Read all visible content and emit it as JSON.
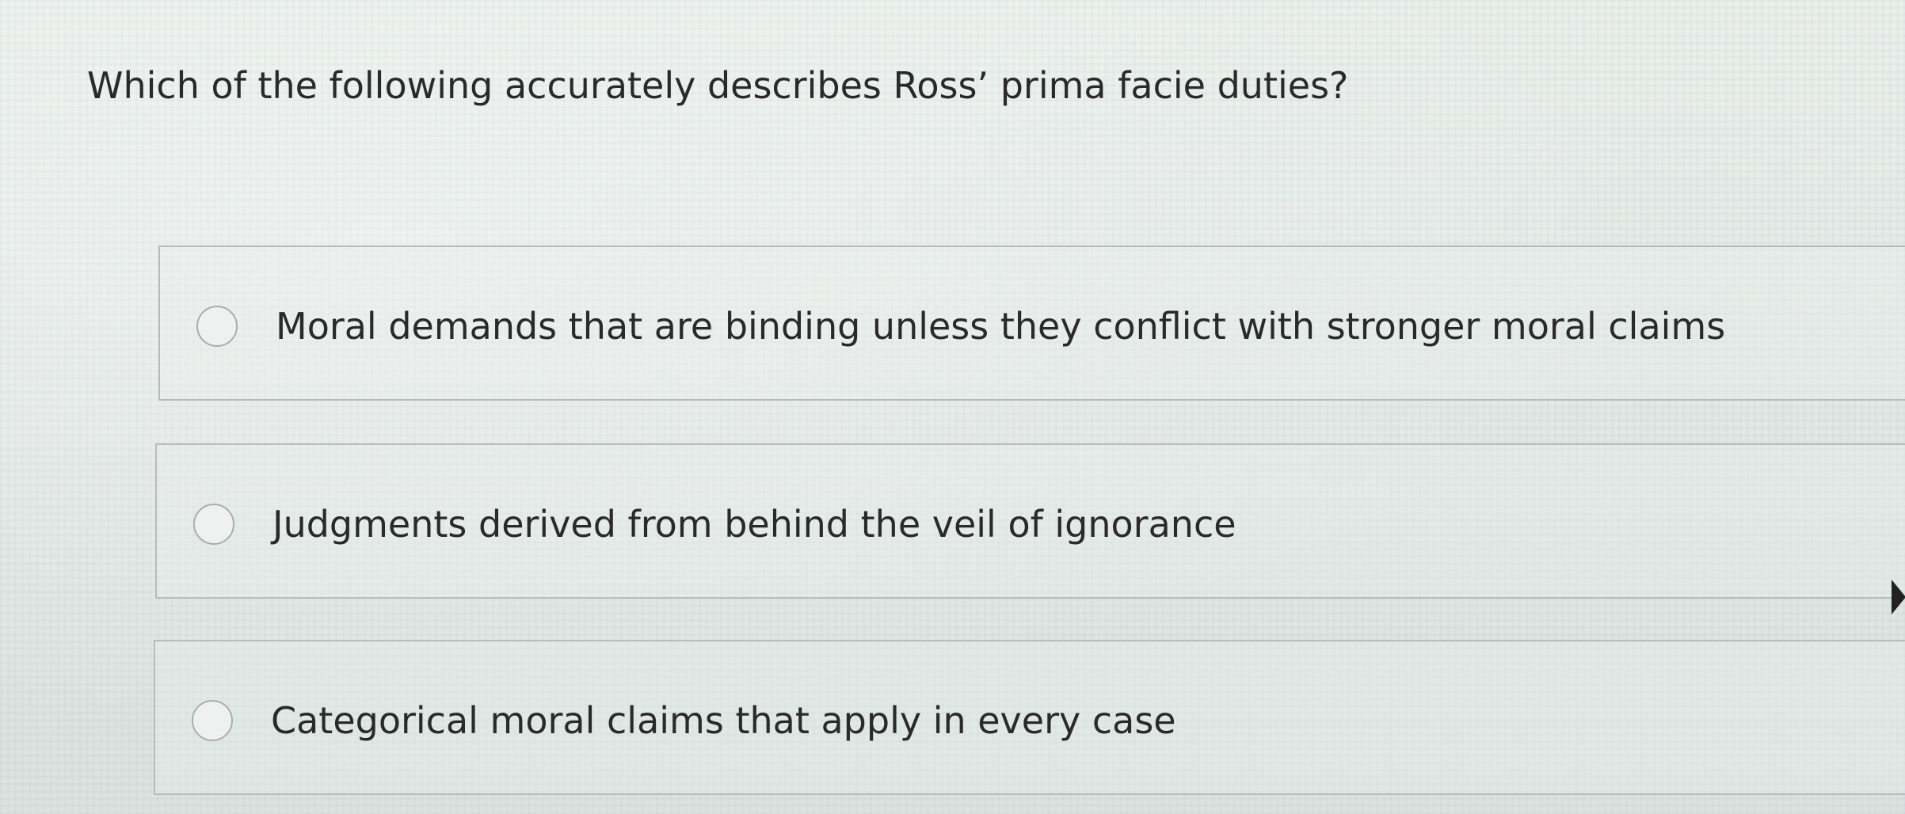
{
  "question": {
    "text": "Which of the following accurately describes Ross’ prima facie duties?"
  },
  "options": [
    {
      "label": "Moral demands that are binding unless they conflict with stronger moral claims",
      "selected": false
    },
    {
      "label": "Judgments derived from behind the veil of ignorance",
      "selected": false
    },
    {
      "label": "Categorical moral claims that apply in every case",
      "selected": false
    }
  ],
  "icons": {
    "radio": "radio-unchecked-icon",
    "cursor": "mouse-pointer-icon"
  },
  "colors": {
    "text": "#2a2a2a",
    "border": "#b7bcbb",
    "radio_border": "#a8aead"
  }
}
